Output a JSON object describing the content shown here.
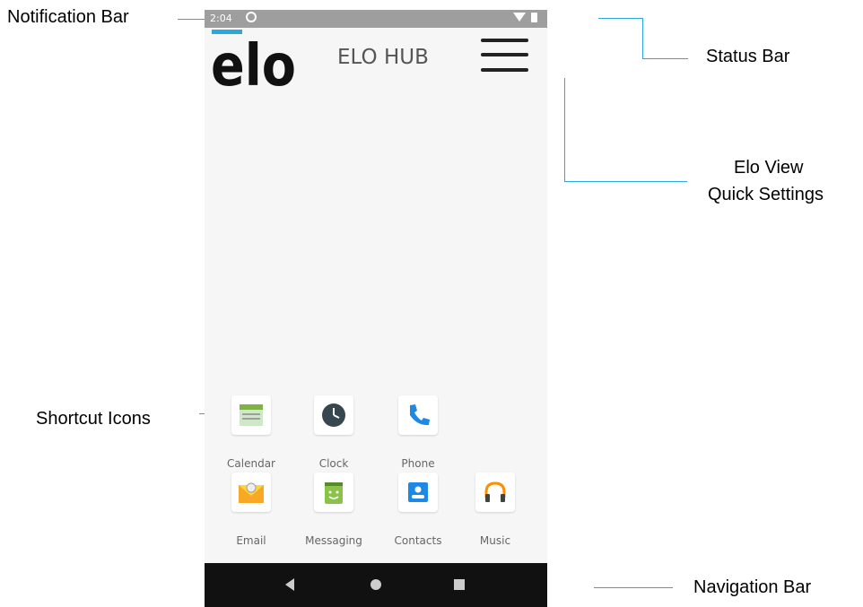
{
  "callouts": {
    "notification_bar": "Notification Bar",
    "status_bar": "Status Bar",
    "quick_settings_line1": "Elo View",
    "quick_settings_line2": "Quick Settings",
    "shortcut_icons": "Shortcut Icons",
    "navigation_bar": "Navigation Bar"
  },
  "status": {
    "time": "2:04"
  },
  "header": {
    "logo": "elo",
    "title": "ELO HUB"
  },
  "apps": [
    {
      "label": "Calendar",
      "icon": "calendar-icon"
    },
    {
      "label": "Clock",
      "icon": "clock-icon"
    },
    {
      "label": "Phone",
      "icon": "phone-icon"
    },
    {
      "label": "Email",
      "icon": "email-icon"
    },
    {
      "label": "Messaging",
      "icon": "messaging-icon"
    },
    {
      "label": "Contacts",
      "icon": "contacts-icon"
    },
    {
      "label": "Music",
      "icon": "headphones-icon"
    }
  ],
  "navigation": [
    "back-icon",
    "home-icon",
    "recents-icon"
  ],
  "colors": {
    "callout_line": "#29a8e0",
    "status_bar": "#9e9e9e",
    "nav_bar": "#111111",
    "screen": "#f6f6f6"
  }
}
